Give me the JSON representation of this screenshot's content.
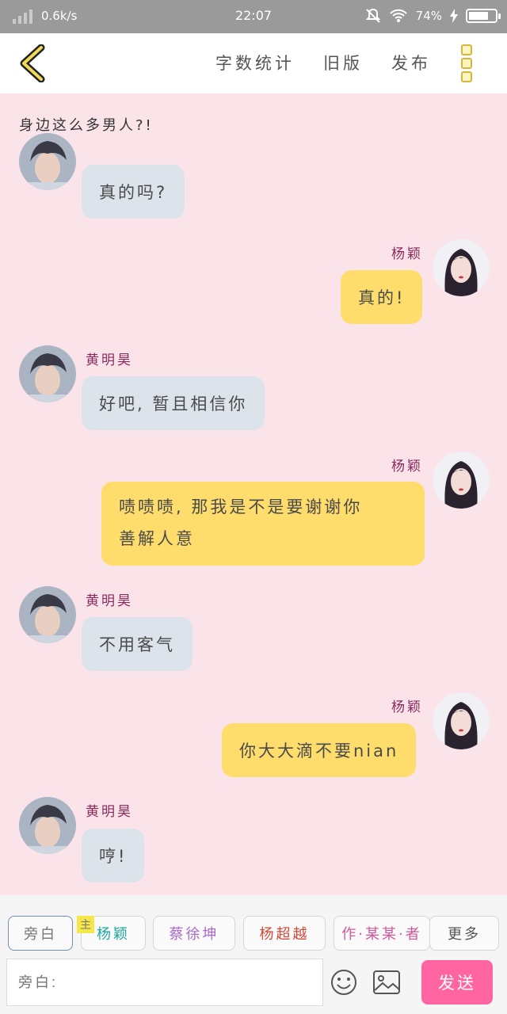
{
  "status_bar": {
    "speed": "0.6k/s",
    "time": "22:07",
    "battery": "74%",
    "battery_level": 0.74
  },
  "top_bar": {
    "actions": [
      "字数统计",
      "旧版",
      "发布"
    ]
  },
  "chat": {
    "narration": "身边这么多男人?!",
    "messages": [
      {
        "side": "left",
        "sender": "",
        "text": "真的吗?"
      },
      {
        "side": "right",
        "sender": "杨颖",
        "text": "真的!"
      },
      {
        "side": "left",
        "sender": "黄明昊",
        "text": "好吧, 暂且相信你"
      },
      {
        "side": "right",
        "sender": "杨颖",
        "text": "啧啧啧, 那我是不是要谢谢你",
        "text2": "善解人意"
      },
      {
        "side": "left",
        "sender": "黄明昊",
        "text": "不用客气"
      },
      {
        "side": "right",
        "sender": "杨颖",
        "text": "你大大滴不要nian"
      },
      {
        "side": "left",
        "sender": "黄明昊",
        "text": "哼!"
      }
    ]
  },
  "composer": {
    "role_chips": [
      {
        "label": "旁白",
        "color": "#777777"
      },
      {
        "label": "杨颖",
        "color": "#1fa7a0"
      },
      {
        "label": "蔡徐坤",
        "color": "#a86ac8"
      },
      {
        "label": "杨超越",
        "color": "#d04a3a"
      },
      {
        "label": "作·某某·者",
        "color": "#d0589a"
      },
      {
        "label": "更多",
        "color": "#555555"
      }
    ],
    "main_tag": "主",
    "input_placeholder": "旁白:",
    "send_label": "发送"
  }
}
